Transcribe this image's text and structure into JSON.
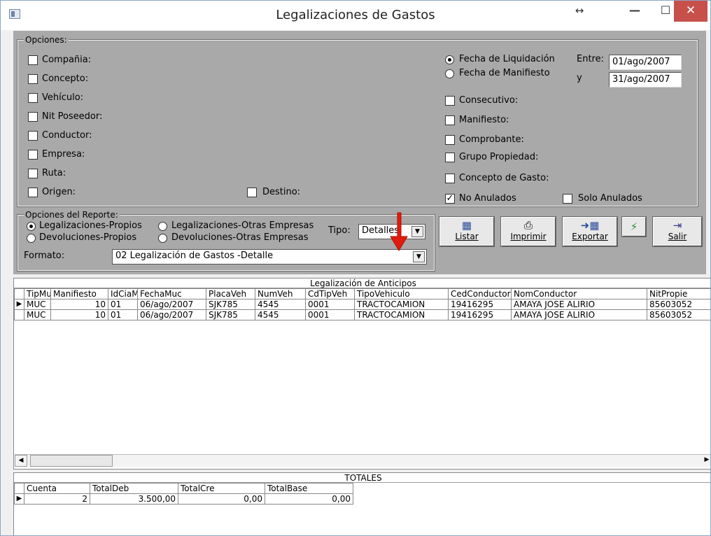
{
  "window": {
    "title": "Legalizaciones de Gastos",
    "controls": {
      "resize": "↔",
      "minimize": "—",
      "maximize": "☐",
      "close": "✕"
    }
  },
  "opciones": {
    "legend": "Opciones:",
    "left_checks": [
      {
        "label": "Compañia:",
        "checked": false
      },
      {
        "label": "Concepto:",
        "checked": false
      },
      {
        "label": "Vehículo:",
        "checked": false
      },
      {
        "label": "Nit Poseedor:",
        "checked": false
      },
      {
        "label": "Conductor:",
        "checked": false
      },
      {
        "label": "Empresa:",
        "checked": false
      },
      {
        "label": "Ruta:",
        "checked": false
      },
      {
        "label": "Origen:",
        "checked": false
      }
    ],
    "destino": {
      "label": "Destino:",
      "checked": false
    },
    "fecha": {
      "liquidacion": {
        "label": "Fecha de Liquidación",
        "selected": true
      },
      "manifiesto": {
        "label": "Fecha de Manifiesto",
        "selected": false
      },
      "entre_label": "Entre:",
      "y_label": "y",
      "desde": "01/ago/2007",
      "hasta": "31/ago/2007"
    },
    "right_checks": [
      {
        "label": "Consecutivo:",
        "checked": false
      },
      {
        "label": "Manifiesto:",
        "checked": false
      },
      {
        "label": "Comprobante:",
        "checked": false
      },
      {
        "label": "Grupo Propiedad:",
        "checked": false
      },
      {
        "label": "Concepto de Gasto:",
        "checked": false
      }
    ],
    "no_anulados": {
      "label": "No Anulados",
      "checked": true
    },
    "solo_anulados": {
      "label": "Solo Anulados",
      "checked": false
    }
  },
  "reporte": {
    "legend": "Opciones del Reporte:",
    "radios": [
      {
        "label": "Legalizaciones-Propios",
        "selected": true
      },
      {
        "label": "Legalizaciones-Otras Empresas",
        "selected": false
      },
      {
        "label": "Devoluciones-Propios",
        "selected": false
      },
      {
        "label": "Devoluciones-Otras Empresas",
        "selected": false
      }
    ],
    "tipo_label": "Tipo:",
    "tipo_value": "Detalles",
    "formato_label": "Formato:",
    "formato_value": "02 Legalización de Gastos -Detalle"
  },
  "toolbar": {
    "listar": "Listar",
    "imprimir": "Imprimir",
    "exportar": "Exportar",
    "salir": "Salir"
  },
  "grid": {
    "caption": "Legalización de Anticipos",
    "columns": [
      "TipMuc",
      "Manifiesto",
      "IdCiaM",
      "FechaMuc",
      "PlacaVeh",
      "NumVeh",
      "CdTipVeh",
      "TipoVehiculo",
      "CedConductor",
      "NomConductor",
      "NitPropie"
    ],
    "rows": [
      [
        "MUC",
        "10",
        "01",
        "06/ago/2007",
        "SJK785",
        "4545",
        "0001",
        "TRACTOCAMION",
        "19416295",
        "AMAYA JOSE ALIRIO",
        "85603052"
      ],
      [
        "MUC",
        "10",
        "01",
        "06/ago/2007",
        "SJK785",
        "4545",
        "0001",
        "TRACTOCAMION",
        "19416295",
        "AMAYA JOSE ALIRIO",
        "85603052"
      ]
    ]
  },
  "totales": {
    "caption": "TOTALES",
    "columns": [
      "Cuenta",
      "TotalDeb",
      "TotalCre",
      "TotalBase"
    ],
    "row": [
      "2",
      "3.500,00",
      "0,00",
      "0,00"
    ]
  }
}
